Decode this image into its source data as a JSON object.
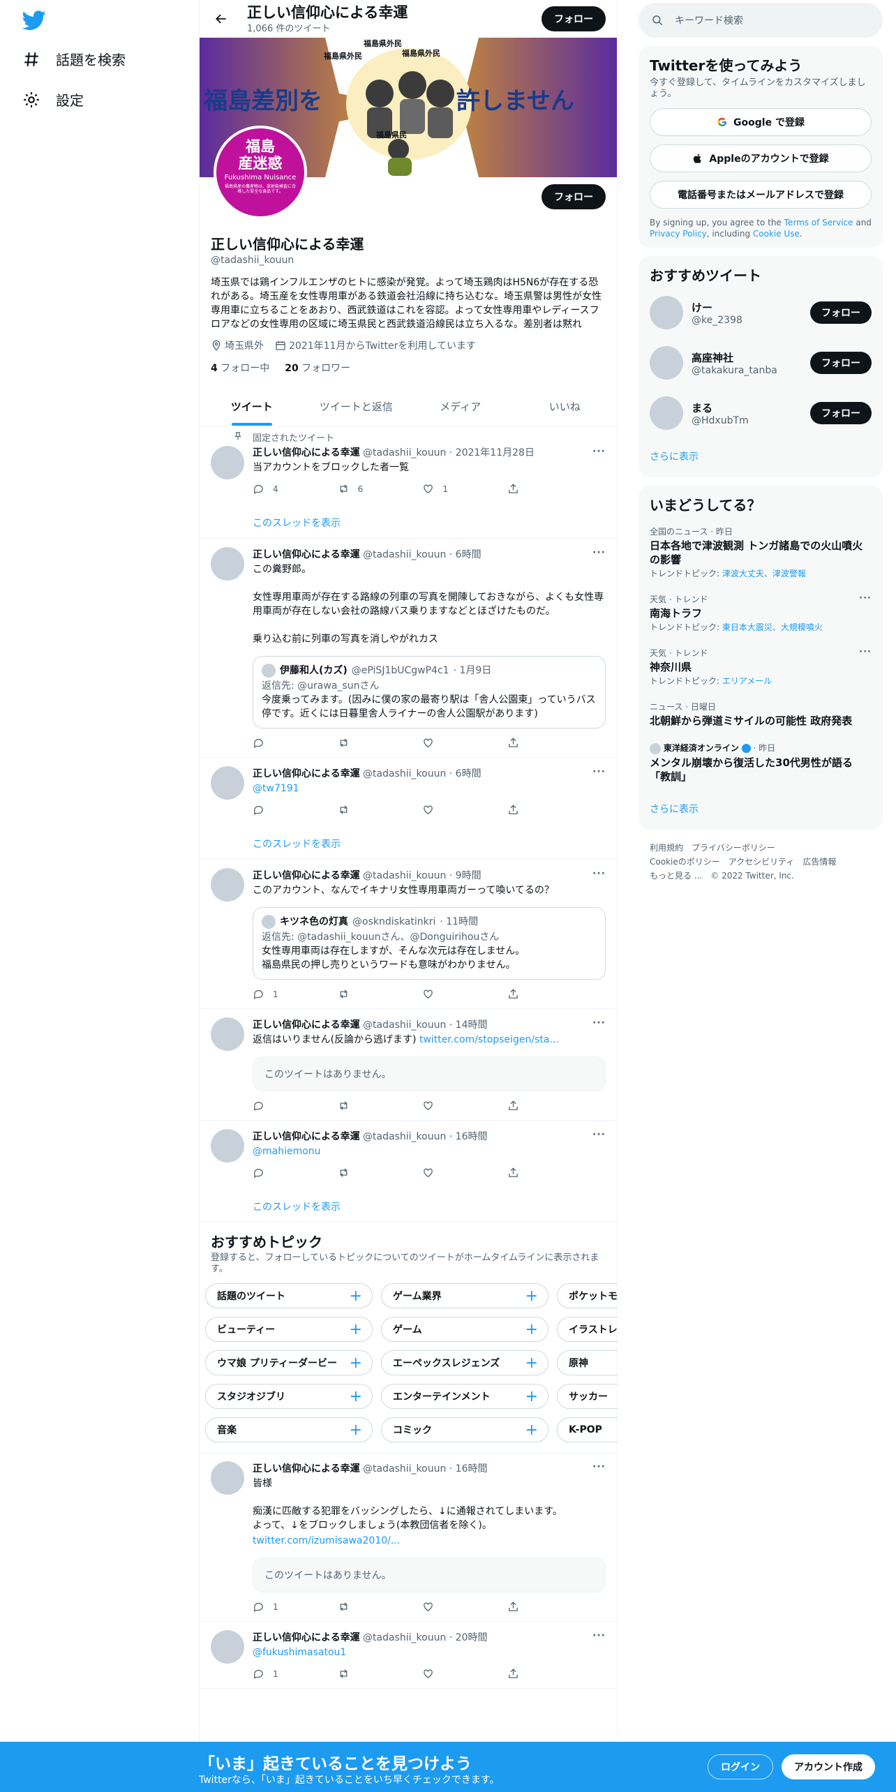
{
  "nav": {
    "explore": "話題を検索",
    "settings": "設定"
  },
  "header": {
    "name": "正しい信仰心による幸運",
    "tweet_count": "1,066 件のツイート",
    "follow": "フォロー"
  },
  "banner": {
    "left_text": "福島差別を",
    "right_text": "許しません",
    "label_a": "福島県外民",
    "label_b": "福島県外民",
    "label_c": "福島県外民",
    "label_d": "福島県民",
    "avatar_line1": "福島",
    "avatar_line2": "産迷惑",
    "avatar_line3": "Fukushima Nuisance",
    "avatar_note": "福島県産の農産物は、放射能検査に合格した安全な食品です。"
  },
  "profile": {
    "name": "正しい信仰心による幸運",
    "handle": "@tadashii_kouun",
    "follow": "フォロー",
    "bio": "埼玉県では鶏インフルエンザのヒトに感染が発覚。よって埼玉鶏肉はH5N6が存在する恐れがある。埼玉産を女性専用車がある鉄道会社沿線に持ち込むな。埼玉県警は男性が女性専用車に立ちることをあおり、西武鉄道はこれを容認。よって女性専用車やレディースフロアなどの女性専用の区域に埼玉県民と西武鉄道沿線民は立ち入るな。差別者は黙れ",
    "location": "埼玉県外",
    "joined": "2021年11月からTwitterを利用しています",
    "following_count": "4",
    "following_label": "フォロー中",
    "followers_count": "20",
    "followers_label": "フォロワー"
  },
  "tabs": [
    {
      "label": "ツイート"
    },
    {
      "label": "ツイートと返信"
    },
    {
      "label": "メディア"
    },
    {
      "label": "いいね"
    }
  ],
  "tweets": {
    "t1": {
      "pinned": "固定されたツイート",
      "name": "正しい信仰心による幸運",
      "handle": "@tadashii_kouun",
      "time": "· 2021年11月28日",
      "body": "当アカウントをブロックした者一覧",
      "replies": "4",
      "retweets": "6",
      "likes": "1",
      "thread": "このスレッドを表示"
    },
    "t2": {
      "name": "正しい信仰心による幸運",
      "handle": "@tadashii_kouun",
      "time": "· 6時間",
      "body": "この糞野郎。\n\n女性専用車両が存在する路線の列車の写真を開陳しておきながら、よくも女性専用車両が存在しない会社の路線バス乗りますなどとほざけたものだ。\n\n乗り込む前に列車の写真を消しやがれカス",
      "quote_name": "伊藤和人(カズ)",
      "quote_handle": "@ePiSJ1bUCgwP4c1",
      "quote_time": "· 1月9日",
      "quote_reply_label": "返信先: ",
      "quote_reply_to": "@urawa_sunさん",
      "quote_body": "今度乗ってみます。(因みに僕の家の最寄り駅は「舎人公園東」っていうバス停です。近くには日暮里舎人ライナーの舎人公園駅があります)"
    },
    "t3": {
      "name": "正しい信仰心による幸運",
      "handle": "@tadashii_kouun",
      "time": "· 6時間",
      "body_link": "@tw7191",
      "thread": "このスレッドを表示"
    },
    "t4": {
      "name": "正しい信仰心による幸運",
      "handle": "@tadashii_kouun",
      "time": "· 9時間",
      "body": "このアカウント、なんでイキナリ女性専用車両ガーって喚いてるの？",
      "quote_name": "キツネ色の灯真",
      "quote_handle": "@oskndiskatinkri",
      "quote_time": "· 11時間",
      "quote_reply_label": "返信先: ",
      "quote_reply_to": "@tadashii_kouunさん、@Donguirihouさん",
      "quote_body": "女性専用車両は存在しますが、そんな次元は存在しません。\n福島県民の押し売りというワードも意味がわかりません。",
      "replies": "1"
    },
    "t5": {
      "name": "正しい信仰心による幸運",
      "handle": "@tadashii_kouun",
      "time": "· 14時間",
      "body": "返信はいりません(反論から逃げます) ",
      "body_link": "twitter.com/stopseigen/sta...",
      "unavailable": "このツイートはありません。"
    },
    "t6": {
      "name": "正しい信仰心による幸運",
      "handle": "@tadashii_kouun",
      "time": "· 16時間",
      "body_link": "@mahiemonu",
      "thread": "このスレッドを表示"
    },
    "t7": {
      "name": "正しい信仰心による幸運",
      "handle": "@tadashii_kouun",
      "time": "· 16時間",
      "body": "皆様\n\n痴漢に匹敵する犯罪をバッシングしたら、↓に通報されてしまいます。\nよって、↓をブロックしましょう(本教団信者を除く)。",
      "body_link": "twitter.com/izumisawa2010/...",
      "unavailable": "このツイートはありません。",
      "replies": "1"
    },
    "t8": {
      "name": "正しい信仰心による幸運",
      "handle": "@tadashii_kouun",
      "time": "· 20時間",
      "body_link": "@fukushimasatou1",
      "replies": "1"
    }
  },
  "topics": {
    "title": "おすすめトピック",
    "subtitle": "登録すると、フォローしているトピックについてのツイートがホームタイムラインに表示されます。",
    "rows": [
      [
        "話題のツイート",
        "ゲーム業界",
        "ポケットモンスター"
      ],
      [
        "ビューティー",
        "ゲーム",
        "イラストレーション"
      ],
      [
        "ウマ娘 プリティーダービー",
        "エーペックスレジェンズ",
        "原神"
      ],
      [
        "スタジオジブリ",
        "エンターテインメント",
        "サッカー"
      ],
      [
        "音楽",
        "コミック",
        "K-POP"
      ]
    ]
  },
  "search": {
    "placeholder": "キーワード検索"
  },
  "signup": {
    "title": "Twitterを使ってみよう",
    "subtitle": "今すぐ登録して、タイムラインをカスタマイズしましょう。",
    "google": "Google で登録",
    "apple": "Appleのアカウントで登録",
    "phone": "電話番号またはメールアドレスで登録",
    "legal_1": "By signing up, you agree to the ",
    "tos": "Terms of Service",
    "legal_2": " and ",
    "privacy": "Privacy Policy",
    "legal_3": ", including ",
    "cookie": "Cookie Use",
    "legal_4": "."
  },
  "who_to_follow": {
    "title": "おすすめツイート",
    "users": [
      {
        "name": "けー",
        "handle": "@ke_2398"
      },
      {
        "name": "高座神社",
        "handle": "@takakura_tanba"
      },
      {
        "name": "まる",
        "handle": "@HdxubTm"
      }
    ],
    "follow": "フォロー",
    "more": "さらに表示"
  },
  "trends": {
    "title": "いまどうしてる？",
    "items": [
      {
        "meta": "全国のニュース · 昨日",
        "title": "日本各地で津波観測 トンガ諸島での火山噴火の影響",
        "topic_label": "トレンドトピック: ",
        "topic_links": "津波大丈夫、津波警報"
      },
      {
        "meta": "天気 · トレンド",
        "title": "南海トラフ",
        "topic_label": "トレンドトピック: ",
        "topic_links": "東日本大震災、大規模噴火"
      },
      {
        "meta": "天気 · トレンド",
        "title": "神奈川県",
        "topic_label": "トレンドトピック: ",
        "topic_links": "エリアメール"
      },
      {
        "meta": "ニュース · 日曜日",
        "title": "北朝鮮から弾道ミサイルの可能性 政府発表"
      },
      {
        "source": "東洋経済オンライン",
        "meta": "· 昨日",
        "title": "メンタル崩壊から復活した30代男性が語る「教訓」"
      }
    ],
    "more": "さらに表示"
  },
  "footer": {
    "terms": "利用規約",
    "privacy": "プライバシーポリシー",
    "cookie": "Cookieのポリシー",
    "accessibility": "アクセシビリティ",
    "ads": "広告情報",
    "more": "もっと見る ...",
    "copyright": "© 2022 Twitter, Inc."
  },
  "bottom_bar": {
    "title": "「いま」起きていることを見つけよう",
    "subtitle": "Twitterなら、「いま」起きていることをいち早くチェックできます。",
    "login": "ログイン",
    "signup": "アカウント作成"
  },
  "colors": {
    "accent": "#1d9bf0",
    "dark": "#0f1419",
    "muted": "#536471",
    "avatar_magenta": "#c0119c"
  }
}
